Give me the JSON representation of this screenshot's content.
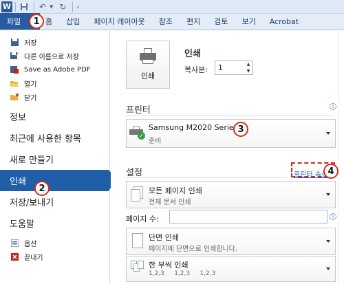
{
  "app": {
    "logo_letter": "W"
  },
  "quick_access": {
    "icons": [
      "save-icon",
      "undo-icon",
      "redo-icon"
    ],
    "caret": "↓"
  },
  "tabs": [
    {
      "label": "파일",
      "active": true
    },
    {
      "label": "홈"
    },
    {
      "label": "삽입"
    },
    {
      "label": "페이지 레이아웃"
    },
    {
      "label": "참조"
    },
    {
      "label": "편지"
    },
    {
      "label": "검토"
    },
    {
      "label": "보기"
    },
    {
      "label": "Acrobat"
    }
  ],
  "nav": {
    "items_small": [
      {
        "label": "저장",
        "icon": "save-icon"
      },
      {
        "label": "다른 이름으로 저장",
        "icon": "save-as-icon"
      },
      {
        "label": "Save as Adobe PDF",
        "icon": "pdf-icon"
      },
      {
        "label": "열기",
        "icon": "open-folder-icon"
      },
      {
        "label": "닫기",
        "icon": "close-folder-icon"
      }
    ],
    "items_large": [
      {
        "label": "정보"
      },
      {
        "label": "최근에 사용한 항목"
      },
      {
        "label": "새로 만들기"
      },
      {
        "label": "인쇄",
        "active": true
      },
      {
        "label": "저장/보내기"
      },
      {
        "label": "도움말"
      }
    ],
    "items_bottom": [
      {
        "label": "옵션",
        "icon": "options-icon"
      },
      {
        "label": "끝내기",
        "icon": "exit-icon"
      }
    ]
  },
  "print": {
    "heading": "인쇄",
    "button_label": "인쇄",
    "copies_label": "복사본:",
    "copies_value": "1"
  },
  "printer": {
    "section_title": "프린터",
    "name": "Samsung M2020 Series",
    "status": "준비",
    "properties_link": "프린터 속성"
  },
  "settings": {
    "section_title": "설정",
    "range_title": "모든 페이지 인쇄",
    "range_sub": "전체 문서 인쇄",
    "pages_label": "페이지 수:",
    "pages_value": "",
    "sides_title": "단면 인쇄",
    "sides_sub": "페이지에 단면으로 인쇄합니다.",
    "collate_title": "한 부씩 인쇄",
    "collate_sub": "1,2,3     1,2,3     1,2,3"
  },
  "annotations": [
    "1",
    "2",
    "3",
    "4"
  ],
  "colors": {
    "file_tab": "#2a5a9f",
    "active_nav": "#1f5fa8",
    "callout_red": "#d92b22",
    "link_blue": "#1a5fb4"
  }
}
